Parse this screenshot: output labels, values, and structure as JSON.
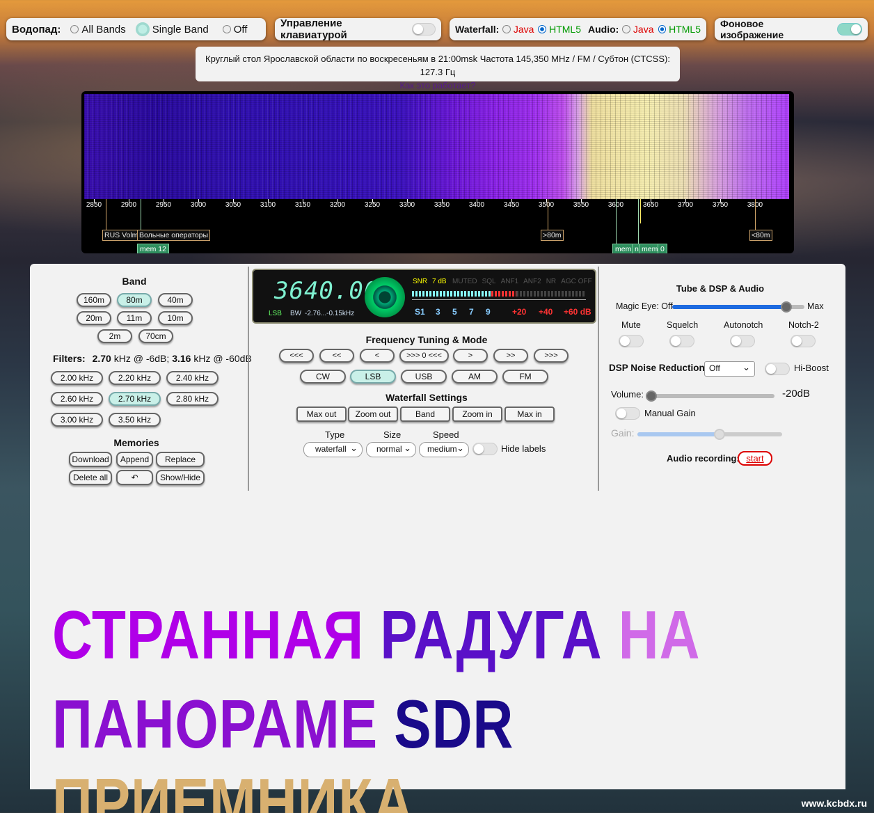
{
  "topbar": {
    "waterfall_label": "Водопад:",
    "options": [
      "All Bands",
      "Single Band",
      "Off"
    ],
    "keyboard_label": "Управление клавиатурой",
    "wf_label": "Waterfall:",
    "java": "Java",
    "html5": "HTML5",
    "audio_label": "Audio:",
    "bg_label": "Фоновое изображение"
  },
  "notice": {
    "text": "Круглый стол Ярославской области по воскресеньям в 21:00msk Частота 145,350 MHz / FM / Субтон (CTCSS): 127.3 Гц",
    "link": "Как это работает?"
  },
  "waterfall": {
    "ticks": [
      "2850",
      "2900",
      "2950",
      "3000",
      "3050",
      "3100",
      "3150",
      "3200",
      "3250",
      "3300",
      "3350",
      "3400",
      "3450",
      "3500",
      "3550",
      "3600",
      "3650",
      "3700",
      "3750",
      "3800"
    ],
    "markers": {
      "rus": "RUS Volm",
      "free": "Вольные операторы",
      "m80": ">80m",
      "l80": "<80m"
    },
    "mems": {
      "mem12": "mem 12",
      "memA": "mem",
      "memB": "n",
      "memC": "mem",
      "memD": "0"
    }
  },
  "band": {
    "title": "Band",
    "buttons": [
      "160m",
      "80m",
      "40m",
      "20m",
      "11m",
      "10m",
      "2m",
      "70cm"
    ]
  },
  "filters": {
    "label": "Filters:",
    "v1": "2.70",
    "t1": "kHz @ -6dB;",
    "v2": "3.16",
    "t2": "kHz @ -60dB",
    "buttons": [
      "2.00 kHz",
      "2.20 kHz",
      "2.40 kHz",
      "2.60 kHz",
      "2.70 kHz",
      "2.80 kHz",
      "3.00 kHz",
      "3.50 kHz"
    ]
  },
  "memories": {
    "title": "Memories",
    "buttons": [
      "Download",
      "Append",
      "Replace",
      "Delete all",
      "↶",
      "Show/Hide"
    ]
  },
  "smeter": {
    "freq": "3640.00",
    "mode": "LSB",
    "bw": "BW",
    "bw_val": "-2.76...-0.15kHz",
    "snr": "SNR",
    "snr_val": "7 dB",
    "flags": [
      "MUTED",
      "SQL",
      "ANF1",
      "ANF2",
      "NR",
      "AGC OFF"
    ],
    "scale": [
      "S1",
      "3",
      "5",
      "7",
      "9",
      "+20",
      "+40",
      "+60 dB"
    ]
  },
  "tuning": {
    "title": "Frequency Tuning & Mode",
    "steps": [
      "<<<",
      "<<",
      "<",
      ">>> 0 <<<",
      ">",
      ">>",
      ">>>"
    ],
    "modes": [
      "CW",
      "LSB",
      "USB",
      "AM",
      "FM"
    ]
  },
  "wfsettings": {
    "title": "Waterfall Settings",
    "buttons": [
      "Max out",
      "Zoom out",
      "Band",
      "Zoom in",
      "Max in"
    ],
    "type_label": "Type",
    "size_label": "Size",
    "speed_label": "Speed",
    "type": "waterfall",
    "size": "normal",
    "speed": "medium",
    "hide": "Hide labels"
  },
  "dsp": {
    "title": "Tube & DSP & Audio",
    "eye_off": "Magic Eye: Off",
    "eye_max": "Max",
    "mute": "Mute",
    "squelch": "Squelch",
    "autonotch": "Autonotch",
    "notch2": "Notch-2",
    "nr_label": "DSP Noise Reduction:",
    "nr_val": "Off",
    "hiboost": "Hi-Boost",
    "volume": "Volume:",
    "volume_val": "-20dB",
    "manual_gain": "Manual Gain",
    "gain": "Gain:",
    "rec": "Audio recording:",
    "start": "start"
  },
  "headline": {
    "line1a": "СТРАННАЯ",
    "line1b": "РАДУГА",
    "line1c": "НА",
    "line2a": "ПАНОРАМЕ",
    "line2b": "SDR",
    "line2c": "ПРИЕМНИКА"
  },
  "watermark": "www.kcbdx.ru",
  "colors": {
    "accent": "#1e6be0",
    "mint": "#8fd8c7",
    "magenta": "#b000e8",
    "navy": "#1a0a8a",
    "gold": "#f0d898"
  }
}
